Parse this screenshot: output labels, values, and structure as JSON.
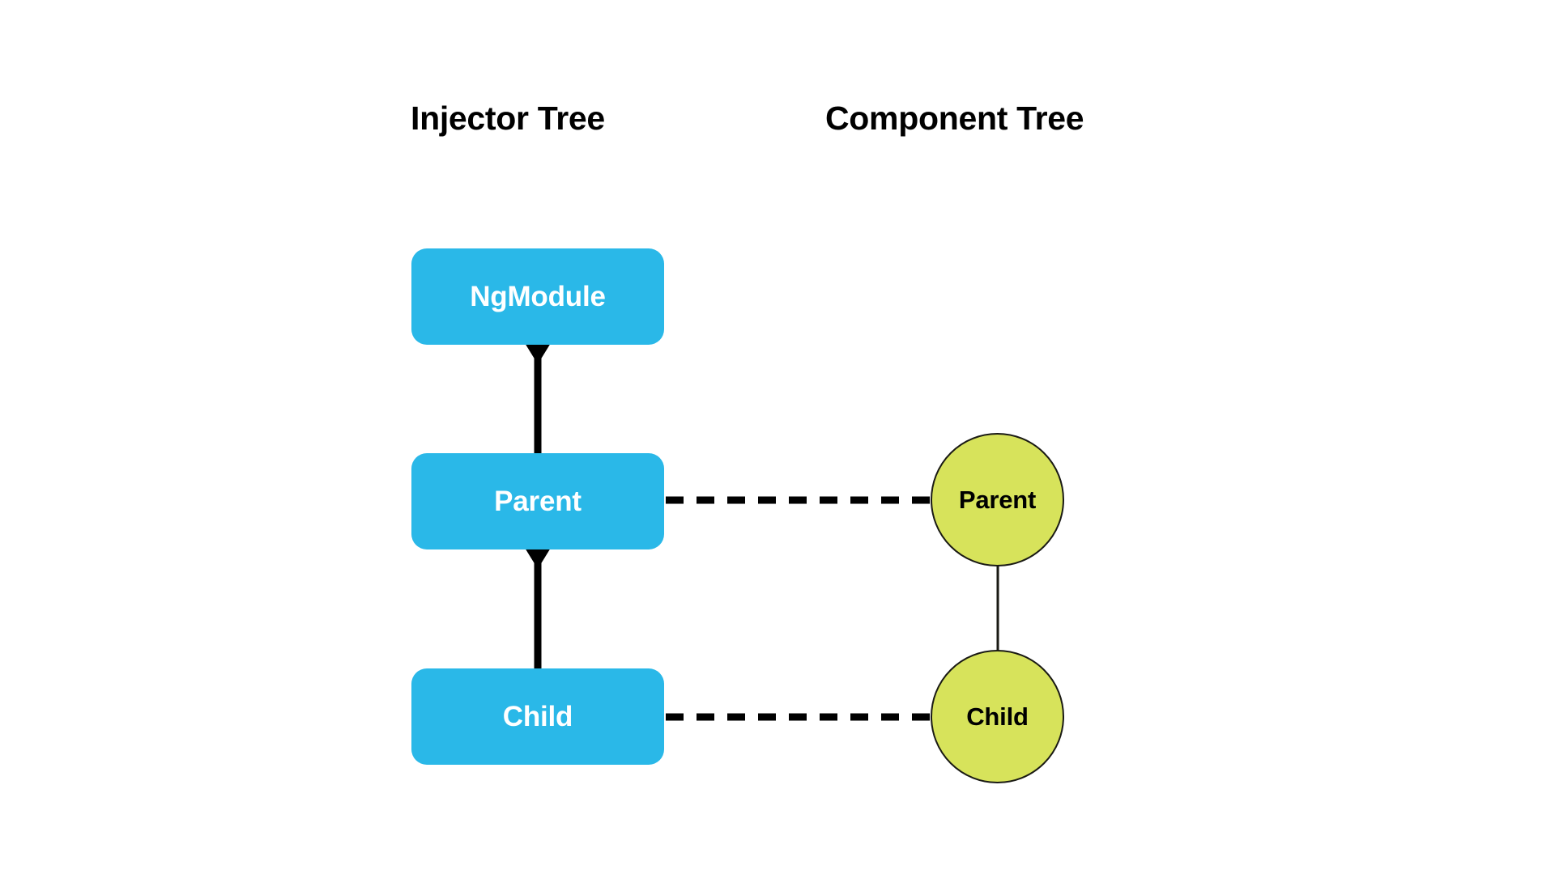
{
  "diagram": {
    "title": "Injector Tree and Component Tree",
    "background_color": "#ffffff",
    "columns": [
      {
        "id": "injector",
        "title": "Injector Tree"
      },
      {
        "id": "component",
        "title": "Component Tree"
      }
    ],
    "injector_tree": {
      "heading": "Injector Tree",
      "node_shape": "rounded-rectangle",
      "node_fill": "#2ab8e8",
      "node_text_color": "#ffffff",
      "nodes": [
        {
          "id": "ngmodule",
          "label": "NgModule"
        },
        {
          "id": "parent",
          "label": "Parent"
        },
        {
          "id": "child",
          "label": "Child"
        }
      ],
      "edges": [
        {
          "from": "ngmodule",
          "to": "parent",
          "style": "solid",
          "arrow": "triangle-down",
          "color": "#000000"
        },
        {
          "from": "parent",
          "to": "child",
          "style": "solid",
          "arrow": "triangle-down",
          "color": "#000000"
        }
      ]
    },
    "component_tree": {
      "heading": "Component Tree",
      "node_shape": "circle",
      "node_fill": "#d7e35b",
      "node_stroke": "#1a1a14",
      "node_text_color": "#000000",
      "nodes": [
        {
          "id": "parent",
          "label": "Parent"
        },
        {
          "id": "child",
          "label": "Child"
        }
      ],
      "edges": [
        {
          "from": "parent",
          "to": "child",
          "style": "solid-thin",
          "arrow": "none",
          "color": "#1a1a14"
        }
      ]
    },
    "cross_links": [
      {
        "from": "injector.parent",
        "to": "component.parent",
        "style": "dashed",
        "color": "#000000"
      },
      {
        "from": "injector.child",
        "to": "component.child",
        "style": "dashed",
        "color": "#000000"
      }
    ]
  }
}
